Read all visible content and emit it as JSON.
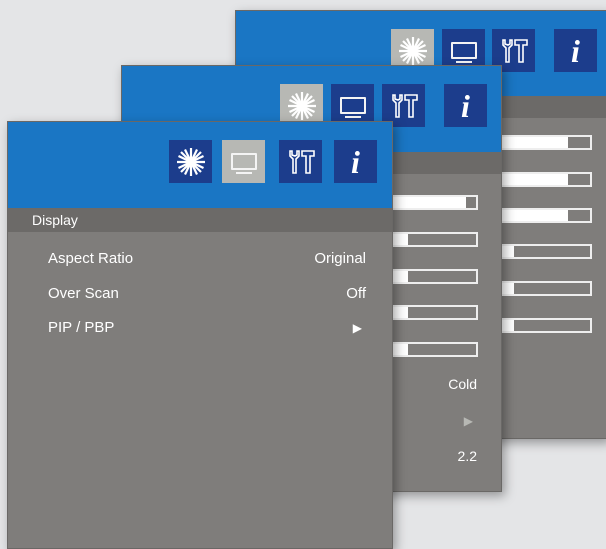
{
  "back_panel": {
    "icons": [
      "sun-icon",
      "monitor-icon",
      "tools-icon",
      "info-icon"
    ],
    "info_glyph": "i",
    "bars": [
      0.92,
      0.92,
      0.92,
      0.33,
      0.33,
      0.33
    ]
  },
  "mid_panel": {
    "icons": [
      "sun-icon",
      "monitor-icon",
      "tools-icon",
      "info-icon"
    ],
    "info_glyph": "i",
    "bars": [
      0.93,
      0.27,
      0.27,
      0.27,
      0.27
    ],
    "values": {
      "color_temp": "Cold",
      "gamma": "2.2"
    },
    "arrow_glyph": "▶"
  },
  "front_panel": {
    "icons": [
      "sun-icon",
      "monitor-icon",
      "tools-icon",
      "info-icon"
    ],
    "info_glyph": "i",
    "section_title": "Display",
    "items": [
      {
        "label": "Aspect Ratio",
        "value": "Original"
      },
      {
        "label": "Over Scan",
        "value": "Off"
      },
      {
        "label": "PIP / PBP",
        "value": "▶"
      }
    ]
  },
  "colors": {
    "header_blue": "#1a76c4",
    "icon_active": "#1c3d8c",
    "icon_inactive": "#b7b8b4",
    "panel_gray": "#7f7d7b"
  }
}
